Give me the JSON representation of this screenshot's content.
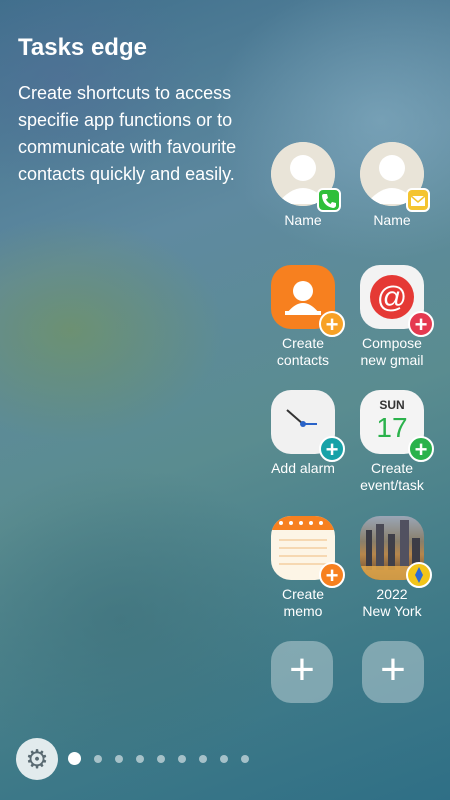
{
  "header": {
    "title": "Tasks edge",
    "description": "Create shortcuts to access specifie app functions or to communicate with favourite contacts quickly and easily."
  },
  "tiles": [
    {
      "label": "Name",
      "icon": "phone-icon"
    },
    {
      "label": "Name",
      "icon": "email-icon"
    },
    {
      "label": "Create\ncontacts",
      "icon": "contacts-icon"
    },
    {
      "label": "Compose\nnew gmail",
      "icon": "gmail-icon"
    },
    {
      "label": "Add alarm",
      "icon": "clock-icon"
    },
    {
      "label": "Create\nevent/task",
      "icon": "calendar-icon",
      "calendar_day": "SUN",
      "calendar_date": "17"
    },
    {
      "label": "Create\nmemo",
      "icon": "memo-icon"
    },
    {
      "label": "2022\nNew York",
      "icon": "gallery-icon"
    }
  ],
  "add_buttons": [
    "+",
    "+"
  ],
  "pagination": {
    "count": 9,
    "active": 0
  },
  "colors": {
    "phone_badge": "#2fbf3a",
    "email_badge": "#f4c430",
    "contacts_orange": "#f7801f",
    "gmail_red": "#e53935",
    "alarm_teal": "#17a2a8",
    "calendar_green": "#2bb24c",
    "memo_orange": "#f7801f"
  }
}
